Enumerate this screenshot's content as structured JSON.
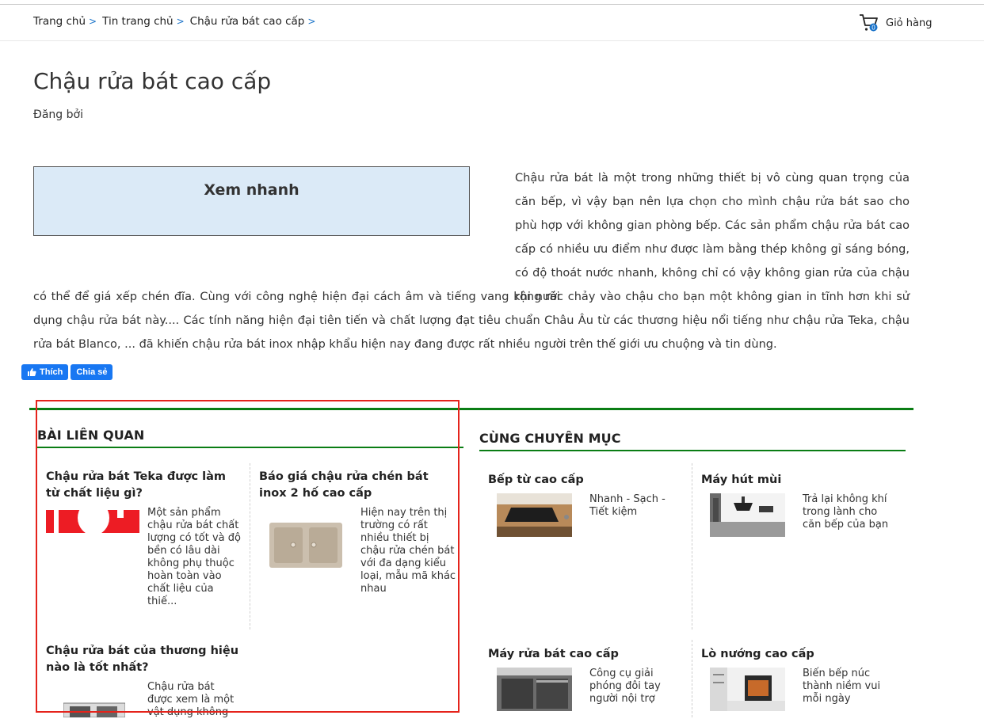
{
  "breadcrumb": {
    "items": [
      "Trang chủ",
      "Tin trang chủ",
      "Chậu rửa bát cao cấp"
    ],
    "separator": ">"
  },
  "cart": {
    "label": "Giỏ hàng",
    "count": "0"
  },
  "article": {
    "title": "Chậu rửa bát cao cấp",
    "byline": "Đăng bởi",
    "quickview_title": "Xem nhanh",
    "intro_right": "Chậu rửa bát là một trong những thiết bị vô cùng quan trọng của căn bếp, vì vậy bạn nên lựa chọn cho mình chậu rửa bát sao cho phù hợp với không gian phòng bếp. Các sản phẩm chậu rửa bát cao cấp có nhiều ưu điểm như được làm bằng thép không gỉ sáng bóng, có độ thoát nước nhanh, không chỉ có vậy không gian rửa của chậu rộng rãi",
    "intro_full": "có thể để giá xếp chén đĩa. Cùng với công nghệ hiện đại cách âm và tiếng vang khi nước chảy vào chậu cho bạn một không gian in tĩnh hơn khi sử dụng chậu rửa bát này.... Các tính năng hiện đại tiên tiến và chất lượng đạt tiêu chuẩn Châu Âu từ các thương hiệu nổi tiếng như chậu rửa Teka, chậu rửa bát Blanco, ... đã khiến chậu rửa bát inox nhập khẩu hiện nay đang được rất nhiều người trên thế giới ưu chuộng và tin dùng."
  },
  "social": {
    "like": "Thích",
    "share": "Chia sẻ"
  },
  "related": {
    "heading": "BÀI LIÊN QUAN",
    "posts": [
      {
        "title": "Chậu rửa bát Teka được làm từ chất liệu gì?",
        "excerpt": "Một sản phẩm chậu rửa bát chất lượng có tốt và độ bền có lâu dài không phụ thuộc hoàn toàn vào chất liệu của thiế..."
      },
      {
        "title": "Báo giá chậu rửa chén bát inox 2 hố cao cấp",
        "excerpt": "Hiện nay trên thị trường có rất nhiều thiết bị chậu rửa chén bát với đa dạng kiểu loại, mẫu mã khác nhau"
      },
      {
        "title": "Chậu rửa bát của thương hiệu nào là tốt nhất?",
        "excerpt": "Chậu rửa bát được xem là một vật dụng không"
      }
    ]
  },
  "same_category": {
    "heading": "CÙNG CHUYÊN MỤC",
    "items": [
      {
        "title": "Bếp từ cao cấp",
        "desc": "Nhanh - Sạch - Tiết kiệm"
      },
      {
        "title": "Máy hút mùi",
        "desc": "Trả lại không khí trong lành cho căn bếp của bạn"
      },
      {
        "title": "Máy rửa bát cao cấp",
        "desc": "Công cụ giải phóng đôi tay người nội trợ"
      },
      {
        "title": "Lò nướng cao cấp",
        "desc": "Biến bếp núc thành niềm vui mỗi ngày"
      }
    ]
  },
  "colors": {
    "accent_green": "#0a7d14",
    "highlight_red": "#e5231b",
    "link_blue": "#1a73c9",
    "quickview_bg": "#dbeaf7",
    "facebook_blue": "#1877f2"
  }
}
